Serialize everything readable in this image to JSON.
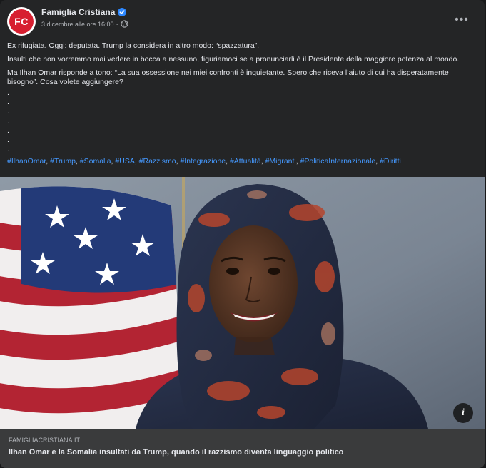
{
  "post": {
    "page_name": "Famiglia Cristiana",
    "avatar_text": "FC",
    "timestamp": "3 dicembre alle ore 16:00",
    "separator": "·",
    "more_label": "•••",
    "paragraphs": [
      "Ex rifugiata. Oggi: deputata. Trump la considera in altro modo: “spazzatura”.",
      "Insulti che non vorremmo mai vedere in bocca a nessuno, figuriamoci se a pronunciarli è il Presidente della maggiore potenza al mondo.",
      "Ma Ilhan Omar risponde a tono:  “La sua ossessione nei miei confronti è inquietante. Spero che riceva l’aiuto di cui ha disperatamente bisogno”. Cosa volete  aggiungere?"
    ],
    "dots": [
      ".",
      ".",
      ".",
      ".",
      ".",
      ".",
      "."
    ],
    "hashtags": [
      "#IlhanOmar",
      "#Trump",
      "#Somalia",
      "#USA",
      "#Razzismo",
      "#Integrazione",
      "#Attualità",
      "#Migranti",
      "#PoliticaInternazionale",
      "#Diritti"
    ],
    "hashtag_separator": ", "
  },
  "link_preview": {
    "domain": "FAMIGLIACRISTIANA.IT",
    "title": "Ilhan Omar e la Somalia insultati da Trump, quando il razzismo diventa linguaggio politico",
    "info_label": "i"
  },
  "colors": {
    "background": "#18191a",
    "card": "#242526",
    "link_box": "#3a3b3c",
    "hashtag": "#4599ff",
    "avatar_red": "#d71f30",
    "verified_blue": "#2d88ff"
  }
}
